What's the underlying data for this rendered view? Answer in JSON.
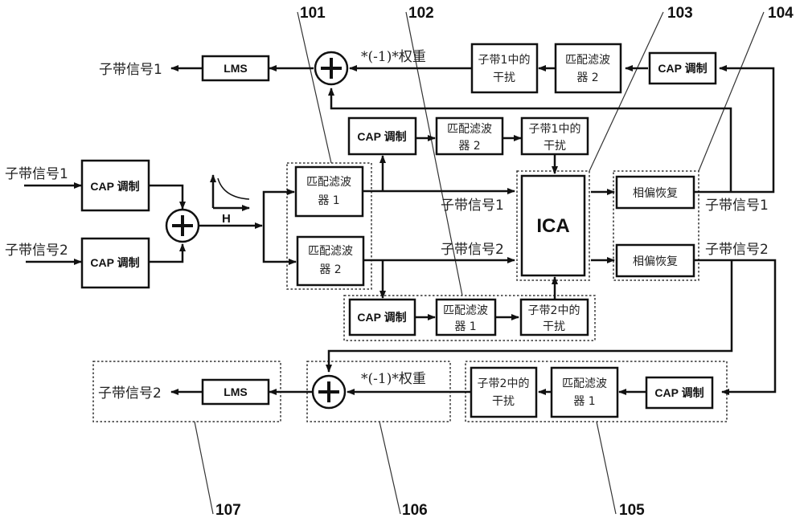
{
  "labels": {
    "cap": "CAP 调制",
    "mf1_line1": "匹配滤波",
    "mf1_line2": "器 1",
    "mf2_line1": "匹配滤波",
    "mf2_line2": "器 2",
    "intf1_line1": "子带1中的",
    "intf1_line2": "干扰",
    "intf2_line1": "子带2中的",
    "intf2_line2": "干扰",
    "ica": "ICA",
    "phase": "相偏恢复",
    "lms": "LMS",
    "weight": "*(-1)*权重",
    "channel": "H",
    "sub1": "子带信号1",
    "sub2": "子带信号2",
    "sum": "+"
  },
  "refs": [
    "101",
    "102",
    "103",
    "104",
    "105",
    "106",
    "107"
  ]
}
